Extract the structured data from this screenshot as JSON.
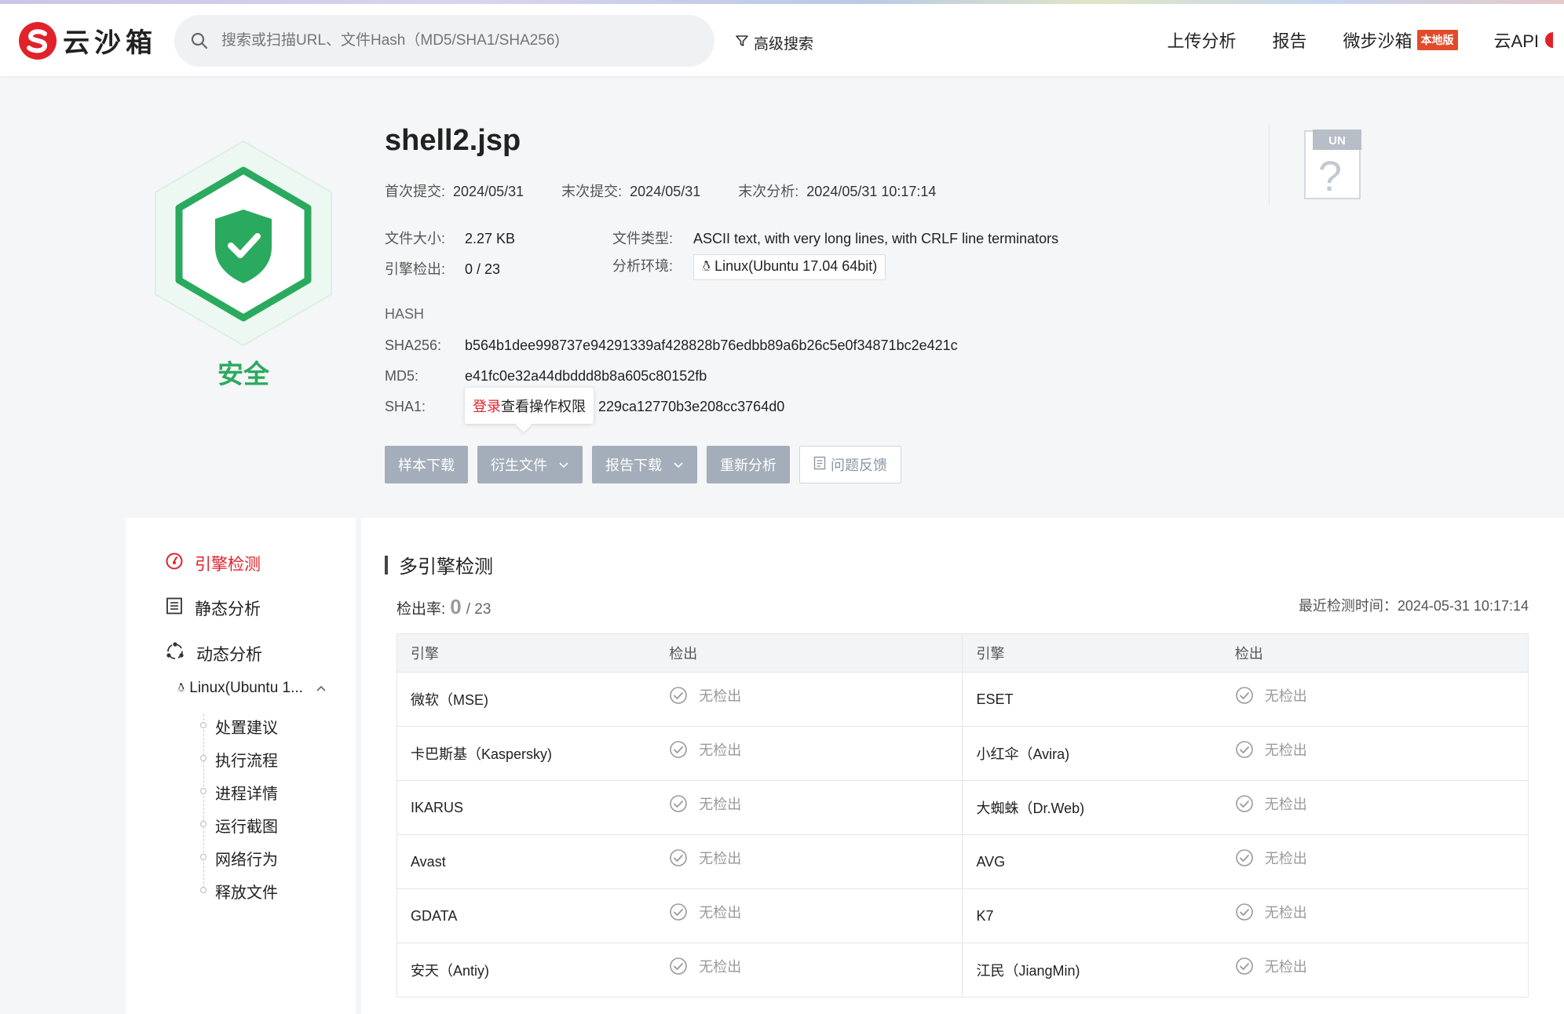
{
  "header": {
    "logo_text": "云沙箱",
    "search_placeholder": "搜索或扫描URL、文件Hash（MD5/SHA1/SHA256)",
    "advanced_search": "高级搜索",
    "nav": {
      "upload": "上传分析",
      "report": "报告",
      "weibu": "微步沙箱",
      "weibu_badge": "本地版",
      "api": "云API"
    }
  },
  "verdict": {
    "label": "安全",
    "color": "#2aaa5e"
  },
  "file": {
    "name": "shell2.jsp",
    "first_submit_label": "首次提交:",
    "first_submit": "2024/05/31",
    "last_submit_label": "末次提交:",
    "last_submit": "2024/05/31",
    "last_analysis_label": "末次分析:",
    "last_analysis": "2024/05/31 10:17:14",
    "size_label": "文件大小:",
    "size": "2.27 KB",
    "type_label": "文件类型:",
    "type": "ASCII text, with very long lines, with CRLF line terminators",
    "engine_label": "引擎检出:",
    "engine": "0 / 23",
    "env_label": "分析环境:",
    "env": "Linux(Ubuntu 17.04 64bit)"
  },
  "hash": {
    "header": "HASH",
    "sha256_label": "SHA256:",
    "sha256": "b564b1dee998737e94291339af428828b76edbb89a6b26c5e0f34871bc2e421c",
    "md5_label": "MD5:",
    "md5": "e41fc0e32a44dbddd8b8a605c80152fb",
    "sha1_label": "SHA1:",
    "sha1_visible": "229ca12770b3e208cc3764d0"
  },
  "tooltip": {
    "login": "登录",
    "text": "查看操作权限"
  },
  "actions": {
    "download_sample": "样本下载",
    "derived_files": "衍生文件",
    "report_download": "报告下载",
    "reanalyze": "重新分析",
    "feedback": "问题反馈"
  },
  "unknown_badge": "UN",
  "sidebar": {
    "engine": "引擎检测",
    "static": "静态分析",
    "dynamic": "动态分析",
    "env": "Linux(Ubuntu 1...",
    "leaves": [
      "处置建议",
      "执行流程",
      "进程详情",
      "运行截图",
      "网络行为",
      "释放文件"
    ]
  },
  "main": {
    "title": "多引擎检测",
    "rate_label": "检出率:",
    "rate_num": "0",
    "rate_den": "/ 23",
    "last_time": "最近检测时间：2024-05-31 10:17:14",
    "columns": [
      "引擎",
      "检出",
      "引擎",
      "检出"
    ],
    "no_detect": "无检出",
    "rows": [
      [
        "微软（MSE)",
        "ESET"
      ],
      [
        "卡巴斯基（Kaspersky)",
        "小红伞（Avira)"
      ],
      [
        "IKARUS",
        "大蜘蛛（Dr.Web)"
      ],
      [
        "Avast",
        "AVG"
      ],
      [
        "GDATA",
        "K7"
      ],
      [
        "安天（Antiy)",
        "江民（JiangMin)"
      ]
    ]
  }
}
